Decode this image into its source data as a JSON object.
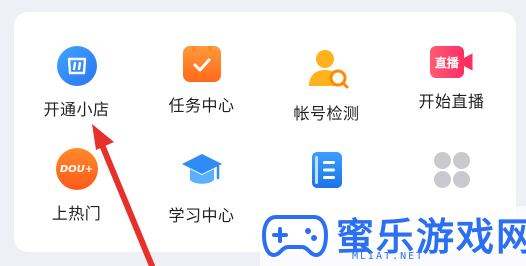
{
  "grid_items": [
    {
      "label": "开通小店",
      "icon": "shop-icon"
    },
    {
      "label": "任务中心",
      "icon": "task-calendar-icon"
    },
    {
      "label": "帐号检测",
      "icon": "account-search-icon"
    },
    {
      "label": "开始直播",
      "icon": "live-camera-icon",
      "badge": "直播"
    },
    {
      "label": "上热门",
      "icon": "dou-plus-icon",
      "badge": "DOU+"
    },
    {
      "label": "学习中心",
      "icon": "graduation-cap-icon"
    },
    {
      "label": "",
      "icon": "book-icon"
    },
    {
      "label": "",
      "icon": "more-icon"
    }
  ],
  "watermark": {
    "title": "蜜乐游戏网",
    "url": "MLIAT.NET",
    "color": "#2b6ff3"
  },
  "colors": {
    "annotation_arrow": "#e8302a",
    "label": "#222222",
    "card": "#ffffff",
    "background": "#eef0f6"
  }
}
